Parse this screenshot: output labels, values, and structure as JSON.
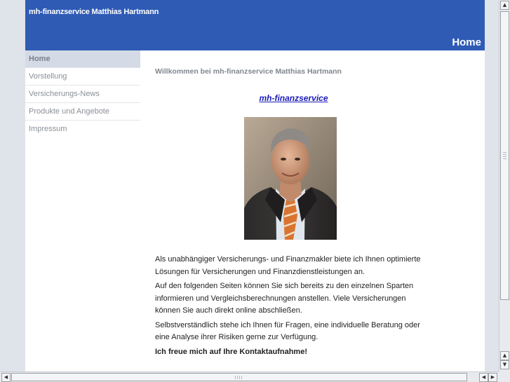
{
  "header": {
    "site_title": "mh-finanzservice Matthias Hartmann",
    "page_heading": "Home"
  },
  "sidebar": {
    "items": [
      {
        "label": "Home",
        "active": true
      },
      {
        "label": "Vorstellung",
        "active": false
      },
      {
        "label": "Versicherungs-News",
        "active": false
      },
      {
        "label": "Produkte und Angebote",
        "active": false
      },
      {
        "label": "Impressum",
        "active": false
      }
    ]
  },
  "main": {
    "welcome": "Willkommen bei mh-finanzservice Matthias Hartmann",
    "brand_link": "mh-finanzservice ",
    "photo_icon": "portrait-photo",
    "paragraphs": [
      "Als unabhängiger Versicherungs- und Finanzmakler biete ich Ihnen optimierte Lösungen für Versicherungen und Finanzdienstleistungen an.",
      "Auf den folgenden Seiten können Sie sich bereits zu den einzelnen Sparten informieren und Vergleichsberechnungen anstellen. Viele Versicherungen können Sie auch direkt online abschließen.",
      "Selbstverständlich stehe ich Ihnen für Fragen, eine individuelle Beratung oder eine Analyse ihrer Risiken gerne zur Verfügung."
    ],
    "closing": "Ich freue mich auf Ihre Kontaktaufnahme!"
  },
  "colors": {
    "header_bg": "#2f5bb5",
    "nav_active_bg": "#d4dbe6",
    "link": "#1a1ab8"
  }
}
